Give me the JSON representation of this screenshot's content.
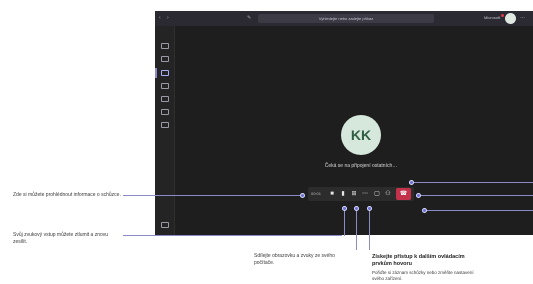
{
  "window": {
    "search_placeholder": "Vyhledejte nebo zadejte příkaz",
    "user_label": "Microsoft",
    "nav_back": "‹",
    "nav_forward": "›",
    "nav_compose": "✎",
    "more_label": "…"
  },
  "meeting": {
    "avatar_initials": "KK",
    "waiting_text": "Čeká se na připojení ostatních…",
    "timer": "00:01"
  },
  "callouts": {
    "info": "Zde si můžete prohlédnout informace o schůzce.",
    "audio": "Svůj zvukový vstup můžete ztlumit a znovu zesílit.",
    "share": "Sdílejte obrazovku a zvuky ze svého počítače.",
    "more_title": "Získejte přístup k dalším ovládacím prvkům hovoru",
    "more_desc": "Pořiďte si záznam schůzky nebo změňte nastavení svého zařízení."
  },
  "colors": {
    "accent": "#6c6fd4",
    "hangup": "#c4314b",
    "window_bg": "#1e1e1e"
  }
}
